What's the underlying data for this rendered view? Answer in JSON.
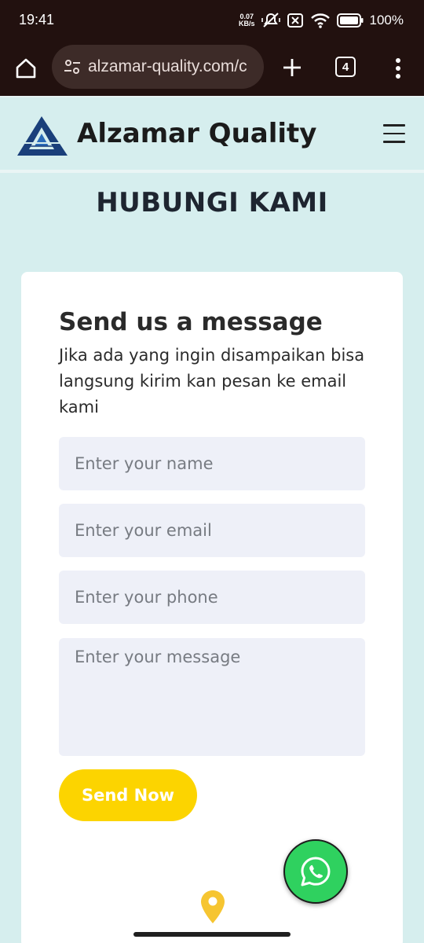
{
  "status_bar": {
    "time": "19:41",
    "net_speed_value": "0.07",
    "net_speed_unit": "KB/s",
    "battery": "100%"
  },
  "browser": {
    "url": "alzamar-quality.com/c",
    "tab_count": "4"
  },
  "site": {
    "brand": "Alzamar Quality",
    "page_title": "HUBUNGI KAMI"
  },
  "form": {
    "title": "Send us a message",
    "description": "Jika ada yang ingin disampaikan bisa langsung kirim kan pesan ke email kami",
    "name_placeholder": "Enter your name",
    "email_placeholder": "Enter your email",
    "phone_placeholder": "Enter your phone",
    "message_placeholder": "Enter your message",
    "submit_label": "Send Now"
  },
  "colors": {
    "page_bg": "#d6eeee",
    "browser_bar": "#22110f",
    "button_yellow": "#fcd400",
    "whatsapp_green": "#2fd15f",
    "pin_yellow": "#f6c531",
    "logo_blue": "#1a3f7a"
  },
  "icons": [
    "home-icon",
    "site-settings-icon",
    "plus-icon",
    "tab-switcher-icon",
    "overflow-menu-icon",
    "hamburger-menu-icon",
    "whatsapp-icon",
    "location-pin-icon"
  ]
}
